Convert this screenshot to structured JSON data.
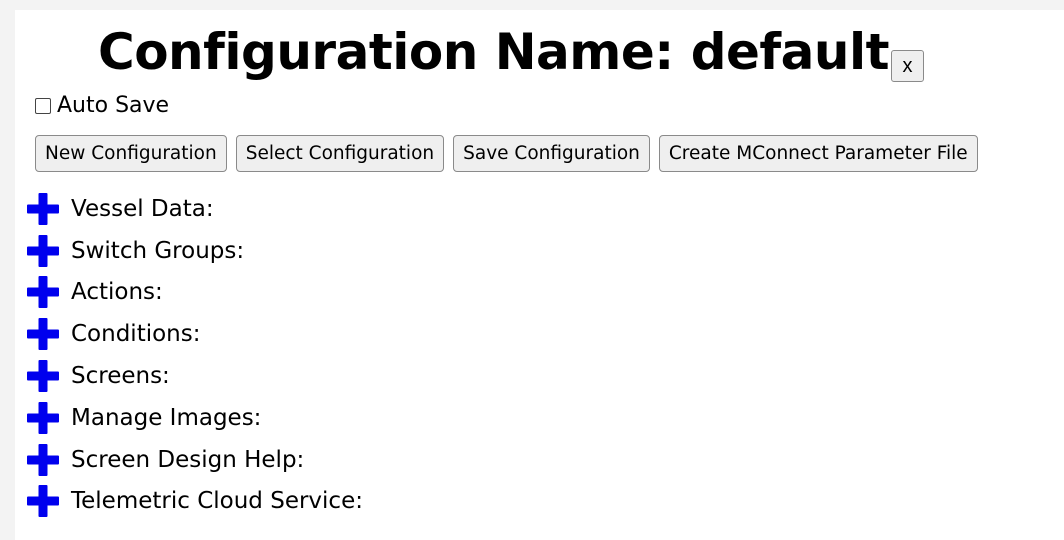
{
  "header": {
    "title": "Configuration Name: default",
    "close_label": "x"
  },
  "auto_save": {
    "label": "Auto Save",
    "checked": false
  },
  "toolbar": {
    "new_label": "New Configuration",
    "select_label": "Select Configuration",
    "save_label": "Save Configuration",
    "create_label": "Create MConnect Parameter File"
  },
  "sections": [
    {
      "label": "Vessel Data:",
      "icon": "plus-icon"
    },
    {
      "label": "Switch Groups:",
      "icon": "plus-icon"
    },
    {
      "label": "Actions:",
      "icon": "plus-icon"
    },
    {
      "label": "Conditions:",
      "icon": "plus-icon"
    },
    {
      "label": "Screens:",
      "icon": "plus-icon"
    },
    {
      "label": "Manage Images:",
      "icon": "plus-icon"
    },
    {
      "label": "Screen Design Help:",
      "icon": "plus-icon"
    },
    {
      "label": "Telemetric Cloud Service:",
      "icon": "plus-icon"
    }
  ],
  "colors": {
    "expand_icon": "#0000ee"
  }
}
